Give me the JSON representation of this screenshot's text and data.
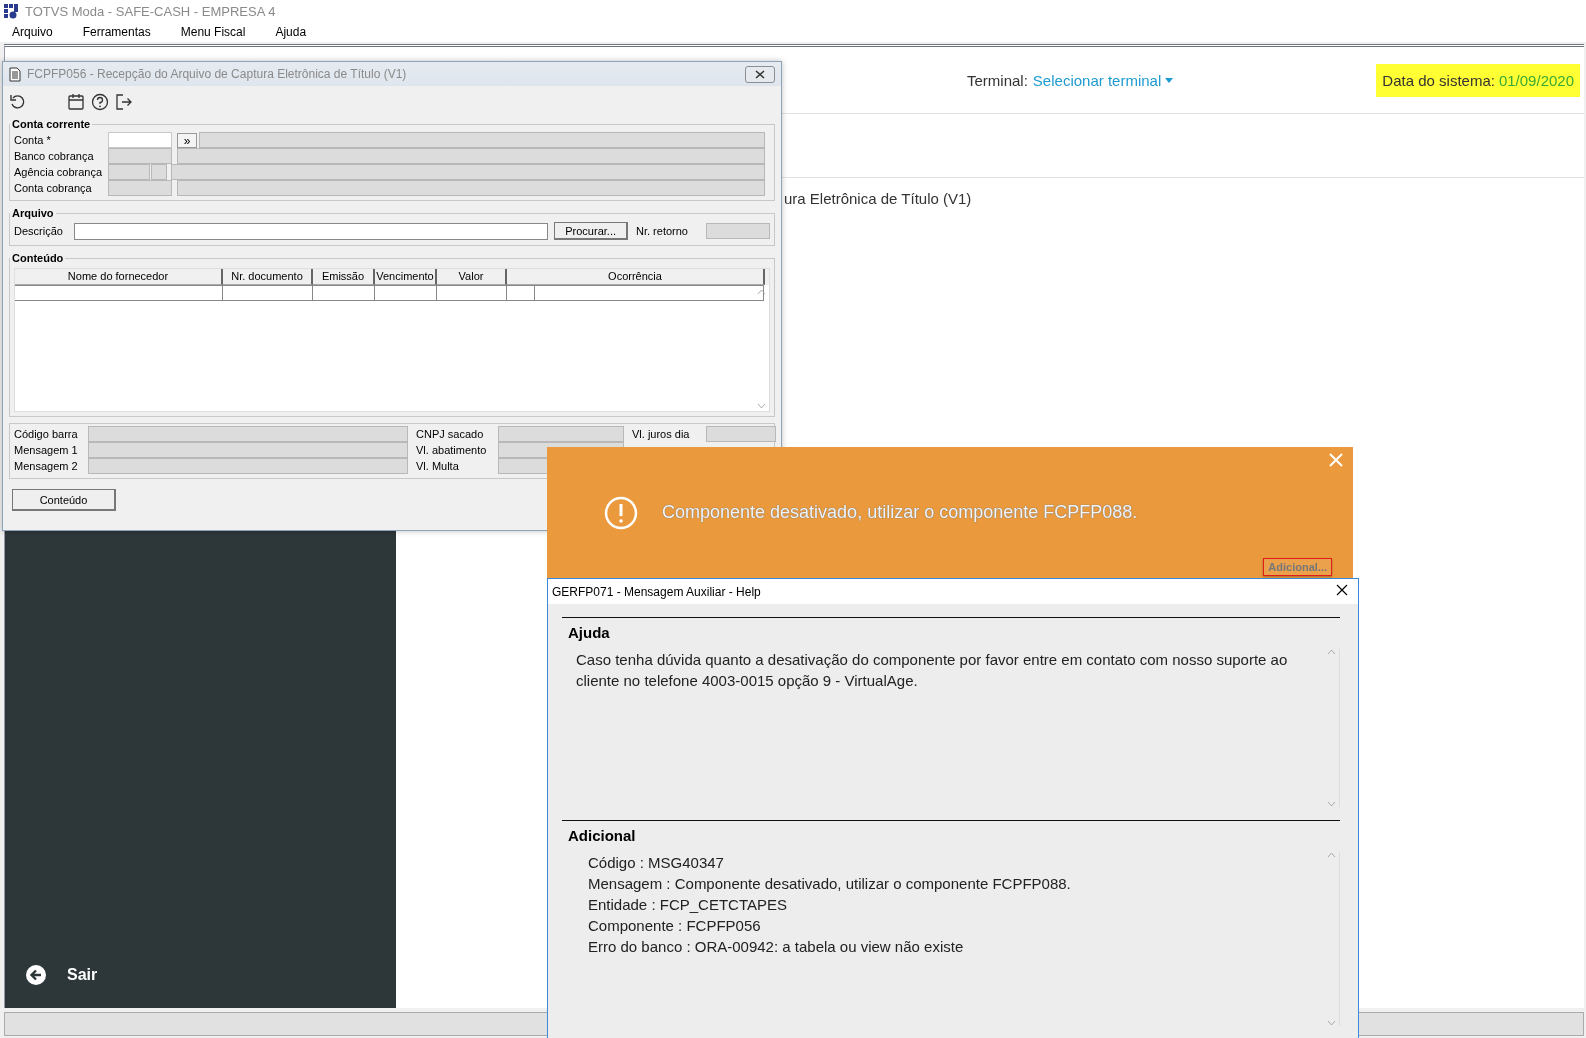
{
  "app_window": {
    "title": "TOTVS Moda - SAFE-CASH - EMPRESA 4"
  },
  "menu": [
    {
      "label": "Arquivo"
    },
    {
      "label": "Ferramentas"
    },
    {
      "label": "Menu Fiscal"
    },
    {
      "label": "Ajuda"
    }
  ],
  "header": {
    "terminal_label": "Terminal:",
    "terminal_value": "Selecionar terminal",
    "date_label": "Data do sistema:",
    "date_value": "01/09/2020"
  },
  "page_heading": "ura Eletrônica de Título (V1)",
  "sidebar": {
    "exit_label": "Sair"
  },
  "form_window": {
    "title": "FCPFP056 - Recepção do Arquivo de Captura Eletrônica de Título (V1)",
    "account_section": {
      "legend": "Conta corrente",
      "rows": [
        {
          "label": "Conta *",
          "fields": [
            {
              "kind": "code",
              "disabled": false
            },
            {
              "kind": "lookup",
              "label": "»"
            },
            {
              "kind": "name",
              "disabled": true
            }
          ]
        },
        {
          "label": "Banco cobrança",
          "fields": [
            {
              "kind": "code",
              "disabled": true
            },
            {
              "kind": "name",
              "disabled": true
            }
          ]
        },
        {
          "label": "Agência cobrança",
          "fields": [
            {
              "kind": "short",
              "disabled": true
            },
            {
              "kind": "digit",
              "disabled": true
            },
            {
              "kind": "name",
              "disabled": true
            }
          ]
        },
        {
          "label": "Conta cobrança",
          "fields": [
            {
              "kind": "code",
              "disabled": true
            },
            {
              "kind": "name",
              "disabled": true
            }
          ]
        }
      ]
    },
    "file_section": {
      "legend": "Arquivo",
      "description_label": "Descrição",
      "browse_button": "Procurar...",
      "return_label": "Nr. retorno"
    },
    "content_section": {
      "legend": "Conteúdo",
      "columns": [
        "Nome do fornecedor",
        "Nr. documento",
        "Emissão",
        "Vencimento",
        "Valor",
        "Ocorrência"
      ]
    },
    "details": [
      [
        {
          "label": "Código barra"
        },
        {
          "label": "Mensagem 1"
        },
        {
          "label": "Mensagem 2"
        }
      ],
      [
        {
          "label": "CNPJ sacado"
        },
        {
          "label": "Vl. abatimento"
        },
        {
          "label": "Vl. Multa"
        }
      ],
      [
        {
          "label": "Vl. juros dia"
        }
      ]
    ],
    "content_button": "Conteúdo"
  },
  "toast": {
    "message": "Componente desativado, utilizar o componente FCPFP088.",
    "details_button": "Adicional..."
  },
  "help_dialog": {
    "title": "GERFP071 - Mensagem Auxiliar - Help",
    "sections": [
      {
        "heading": "Ajuda",
        "lines": [
          "Caso tenha dúvida quanto a desativação do componente por favor entre em contato com nosso suporte ao cliente no telefone 4003-0015 opção 9 - VirtualAge."
        ]
      },
      {
        "heading": "Adicional",
        "lines": [
          "Código : MSG40347",
          "Mensagem : Componente desativado, utilizar o componente FCPFP088.",
          "Entidade : FCP_CETCTAPES",
          "Componente : FCPFP056",
          "Erro do banco : ORA-00942: a tabela ou view não existe"
        ]
      }
    ]
  }
}
